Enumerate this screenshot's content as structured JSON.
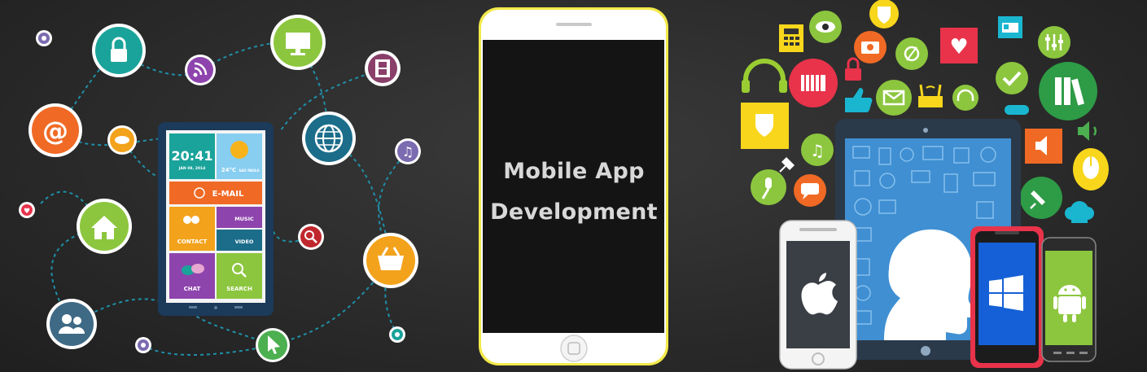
{
  "banner": {
    "title_line1": "Mobile App",
    "title_line2": "Development"
  },
  "left_tablet": {
    "clock_time": "20:41",
    "clock_date": "JAN 08, 2014",
    "weather_temp": "24°C",
    "weather_city": "SAO PAULO",
    "email_label": "E-MAIL",
    "contact_label": "CONTACT",
    "music_label": "MUSIC",
    "video_label": "VIDEO",
    "chat_label": "CHAT",
    "search_label": "SEARCH"
  },
  "colors": {
    "background": "#2a2a2a",
    "phone_frame": "#ffffff",
    "phone_border": "#f2e94a",
    "phone_screen": "#141414",
    "caption_text": "#d8d8d8",
    "teal": "#1aa39a",
    "orange": "#f06a25",
    "lime": "#8cc63e",
    "purple": "#8e44ad",
    "red": "#e8334a"
  },
  "icons": {
    "left_network": [
      "lock-icon",
      "rss-icon",
      "monitor-icon",
      "film-icon",
      "at-icon",
      "chat-bubble-icon",
      "globe-icon",
      "music-note-icon",
      "home-icon",
      "heart-icon",
      "search-icon",
      "basket-icon",
      "users-icon",
      "target-icon",
      "cursor-icon",
      "plus-icon"
    ],
    "right_cluster": [
      "headphones-icon",
      "calculator-icon",
      "eye-icon",
      "shield-icon",
      "camera-icon",
      "satellite-icon",
      "heart-icon",
      "id-card-icon",
      "sliders-icon",
      "equalizer-icon",
      "lock-icon",
      "thumbs-up-icon",
      "mail-icon",
      "wifi-router-icon",
      "check-icon",
      "books-icon",
      "gamepad-icon",
      "speaker-icon",
      "mouse-icon",
      "pin-icon",
      "chef-hat-icon",
      "microphone-icon",
      "chat-icon",
      "music-note-icon",
      "apple-logo",
      "windows-logo",
      "android-logo"
    ]
  }
}
